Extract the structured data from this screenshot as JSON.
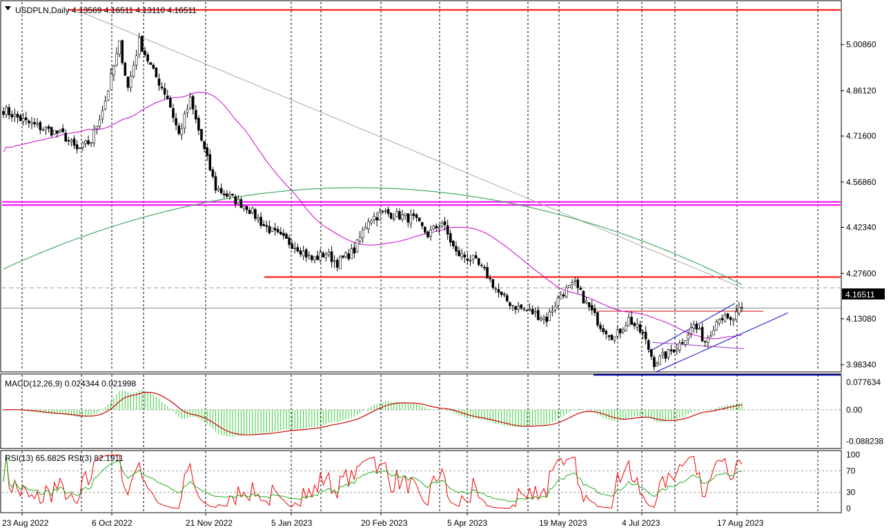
{
  "chart_data": {
    "type": "candlestick",
    "instrument": "USDPLN",
    "timeframe": "Daily",
    "header": "USDPLN,Daily  4.13569 4.16511 4.13110 4.16511",
    "ohlc_last": {
      "open": 4.13569,
      "high": 4.16511,
      "low": 4.1311,
      "close": 4.16511
    },
    "current_price_label": "4.16511",
    "price_axis_ticks": [
      "5.00860",
      "4.86120",
      "4.71600",
      "4.56860",
      "4.42340",
      "4.27600",
      "4.13080",
      "3.98340"
    ],
    "price_range": [
      3.965,
      5.145
    ],
    "date_labels": [
      "23 Aug 2022",
      "6 Oct 2022",
      "21 Nov 2022",
      "5 Jan 2023",
      "20 Feb 2023",
      "5 Apr 2023",
      "19 May 2023",
      "4 Jul 2023",
      "17 Aug 2023"
    ],
    "key_points": [
      {
        "date": "23 Aug 2022",
        "close": 4.75
      },
      {
        "date": "6 Oct 2022",
        "close": 5.0
      },
      {
        "date": "21 Nov 2022",
        "close": 4.5
      },
      {
        "date": "5 Jan 2023",
        "close": 4.34
      },
      {
        "date": "20 Feb 2023",
        "close": 4.46
      },
      {
        "date": "5 Apr 2023",
        "close": 4.29
      },
      {
        "date": "19 May 2023",
        "close": 4.21
      },
      {
        "date": "4 Jul 2023",
        "close": 3.99
      },
      {
        "date": "17 Aug 2023",
        "close": 4.13
      }
    ],
    "levels": [
      {
        "price": 5.12,
        "color": "#ff0000"
      },
      {
        "price": 4.505,
        "color": "#ff00ff"
      },
      {
        "price": 4.495,
        "color": "#ff00ff"
      },
      {
        "price": 4.2645,
        "color": "#ff0000"
      },
      {
        "price": 4.23,
        "color": "#999999"
      },
      {
        "price": 3.951,
        "color": "#0000aa"
      }
    ],
    "moving_averages": [
      {
        "color": "#cc00cc"
      },
      {
        "color": "#229944"
      }
    ],
    "macd": {
      "label": "MACD(12,26,9) 0.024344 0.021998",
      "ticks": [
        "0.077634",
        "0.00",
        "-0.088238"
      ],
      "range": [
        -0.105,
        0.095
      ],
      "histogram_color": "#33cc33",
      "signal_color": "#cc0000"
    },
    "rsi": {
      "label": "RSI(13) 65.6825  RSI(3) 82.1911",
      "ticks": [
        "100",
        "70",
        "30",
        "0"
      ],
      "levels": [
        70,
        30
      ],
      "rsi13_color": "#22aa22",
      "rsi3_color": "#ee0000"
    },
    "colors": {
      "bull": "#ffffff",
      "bear": "#000000",
      "grid": "#000000"
    }
  }
}
